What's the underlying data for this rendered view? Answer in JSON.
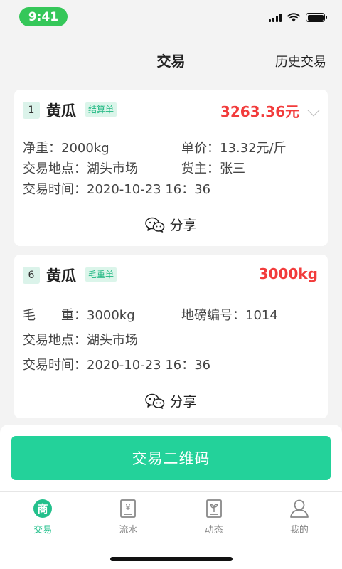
{
  "status_bar": {
    "time": "9:41"
  },
  "nav": {
    "title": "交易",
    "history": "历史交易"
  },
  "cards": [
    {
      "number": "1",
      "product": "黄瓜",
      "tag": "结算单",
      "amount": "3263.36元",
      "rows": [
        {
          "left": "净重：2000kg",
          "right": "单价：13.32元/斤"
        },
        {
          "left": "交易地点：湖头市场",
          "right": "货主：张三"
        },
        {
          "left": "交易时间：2020-10-23 16：36",
          "right": ""
        }
      ],
      "share": "分享"
    },
    {
      "number": "6",
      "product": "黄瓜",
      "tag": "毛重单",
      "amount": "3000kg",
      "rows": [
        {
          "left": "毛　　重：3000kg",
          "right": "地磅编号：1014"
        },
        {
          "left": "交易地点：湖头市场",
          "right": ""
        },
        {
          "left": "交易时间：2020-10-23 16：36",
          "right": ""
        }
      ],
      "share": "分享"
    }
  ],
  "qr_button": "交易二维码",
  "tabs": [
    {
      "label": "交易",
      "icon": "store-icon",
      "active": true
    },
    {
      "label": "流水",
      "icon": "ledger-icon",
      "active": false
    },
    {
      "label": "动态",
      "icon": "sprout-icon",
      "active": false
    },
    {
      "label": "我的",
      "icon": "person-icon",
      "active": false
    }
  ],
  "colors": {
    "accent": "#23d29a",
    "amount": "#f23c3c",
    "status_pill": "#35c759"
  }
}
